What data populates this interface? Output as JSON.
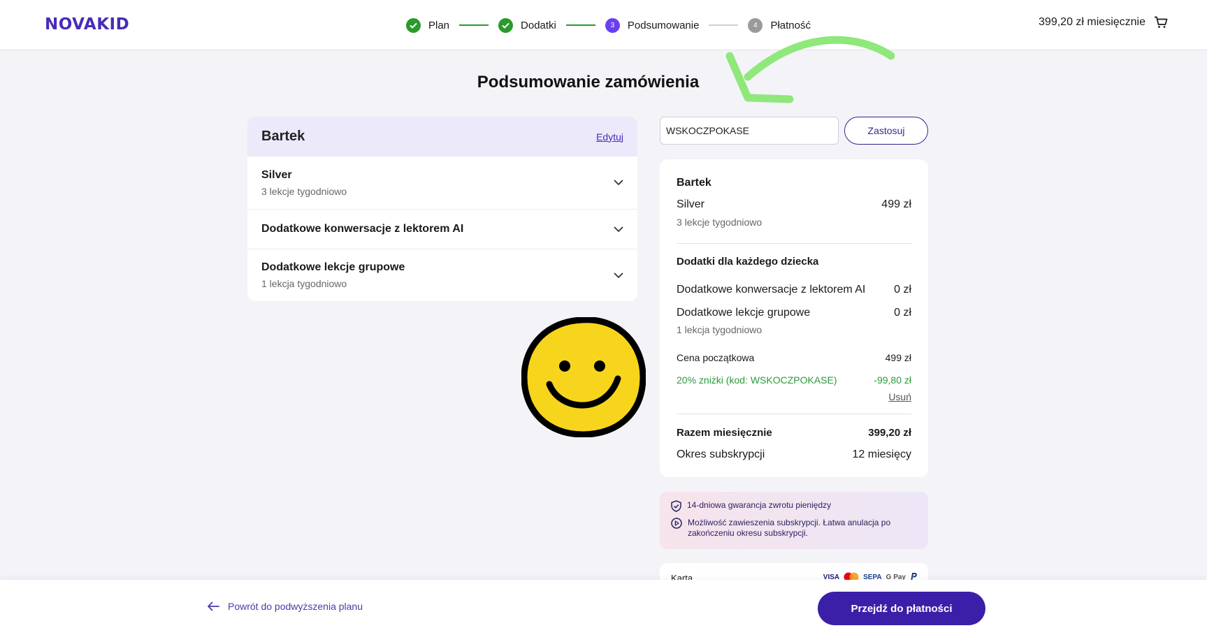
{
  "header": {
    "logo": "NOVAKID",
    "steps": [
      {
        "number": "1",
        "label": "Plan",
        "state": "done"
      },
      {
        "number": "2",
        "label": "Dodatki",
        "state": "done"
      },
      {
        "number": "3",
        "label": "Podsumowanie",
        "state": "current"
      },
      {
        "number": "4",
        "label": "Płatność",
        "state": "todo"
      }
    ],
    "cart_total": "399,20 zł miesięcznie"
  },
  "page_title": "Podsumowanie zamówienia",
  "child_card": {
    "name": "Bartek",
    "edit_label": "Edytuj",
    "items": [
      {
        "title": "Silver",
        "subtitle": "3 lekcje tygodniowo"
      },
      {
        "title": "Dodatkowe konwersacje z lektorem AI",
        "subtitle": ""
      },
      {
        "title": "Dodatkowe lekcje grupowe",
        "subtitle": "1 lekcja tygodniowo"
      }
    ]
  },
  "promo": {
    "code_value": "WSKOCZPOKASE",
    "apply_label": "Zastosuj"
  },
  "summary": {
    "child_name": "Bartek",
    "plan_name": "Silver",
    "plan_price": "499 zł",
    "plan_detail": "3 lekcje tygodniowo",
    "addons_heading": "Dodatki dla każdego dziecka",
    "addon_ai_label": "Dodatkowe konwersacje z lektorem AI",
    "addon_ai_price": "0 zł",
    "addon_group_label": "Dodatkowe lekcje grupowe",
    "addon_group_price": "0 zł",
    "addon_group_detail": "1 lekcja tygodniowo",
    "start_price_label": "Cena początkowa",
    "start_price_value": "499 zł",
    "discount_label": "20% zniżki (kod: WSKOCZPOKASE)",
    "discount_value": "-99,80 zł",
    "remove_label": "Usuń",
    "total_label": "Razem miesięcznie",
    "total_value": "399,20 zł",
    "period_label": "Okres subskrypcji",
    "period_value": "12 miesięcy"
  },
  "guarantee": {
    "refund": "14-dniowa gwarancja zwrotu pieniędzy",
    "pause": "Możliwość zawieszenia subskrypcji. Łatwa anulacja po zakończeniu okresu subskrypcji."
  },
  "payment": {
    "card_label": "Karta",
    "methods": [
      "VISA",
      "SEPA",
      "G Pay"
    ]
  },
  "footer": {
    "back_label": "Powrót do podwyższenia planu",
    "continue_label": "Przejdź do płatności"
  },
  "colors": {
    "brand": "#4a2bb8",
    "primary_button": "#3b1fa8",
    "success": "#2a9a2a",
    "annotation_arrow": "#8ee87a",
    "smiley": "#f7d51d"
  }
}
